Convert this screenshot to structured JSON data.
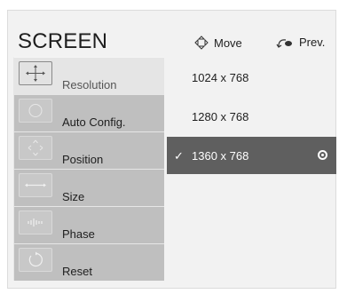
{
  "screen_title": "SCREEN",
  "hints": {
    "move": "Move",
    "prev": "Prev."
  },
  "menu": [
    {
      "label": "Resolution",
      "icon": "resolution-icon",
      "active": true
    },
    {
      "label": "Auto Config.",
      "icon": "auto-config-icon",
      "active": false
    },
    {
      "label": "Position",
      "icon": "position-icon",
      "active": false
    },
    {
      "label": "Size",
      "icon": "size-icon",
      "active": false
    },
    {
      "label": "Phase",
      "icon": "phase-icon",
      "active": false
    },
    {
      "label": "Reset",
      "icon": "reset-icon",
      "active": false
    }
  ],
  "resolutions": [
    {
      "label": "1024 x 768",
      "selected": false
    },
    {
      "label": "1280 x 768",
      "selected": false
    },
    {
      "label": "1360 x 768",
      "selected": true
    }
  ],
  "check_mark": "✓"
}
